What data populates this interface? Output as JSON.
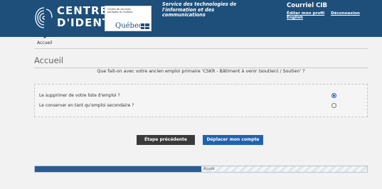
{
  "header": {
    "logo_line1": "CENTRE",
    "logo_line2": "D'IDENTITÉ",
    "quebec_small": "Centre de services partagés du Québec",
    "quebec_word": "Québec",
    "service_text": "Service des technologies de l'information et des communications",
    "courriel": "Courriel CIB",
    "links": [
      "Éditer mon profil",
      "Déconnexion",
      "English"
    ]
  },
  "breadcrumb": {
    "label": "Accueil"
  },
  "page": {
    "title": "Accueil",
    "question": "Que fait-on avec votre ancien emploi primaire 'CSKR - Bâtiment à venir (soutien) / Soutien' ?",
    "options": [
      {
        "label": "Le supprimer de votre liste d'emploi ?",
        "selected": true
      },
      {
        "label": "Le conserver en tant qu'emploi secondaire ?",
        "selected": false
      }
    ]
  },
  "buttons": {
    "previous": "Étape précédente",
    "next": "Déplacer mon compte"
  },
  "progress": {
    "value": 0.5,
    "label": "Ajusté"
  },
  "colors": {
    "header": "#1e4f7a",
    "primary_button": "#1f63b0",
    "secondary_button": "#3a3a3a"
  }
}
